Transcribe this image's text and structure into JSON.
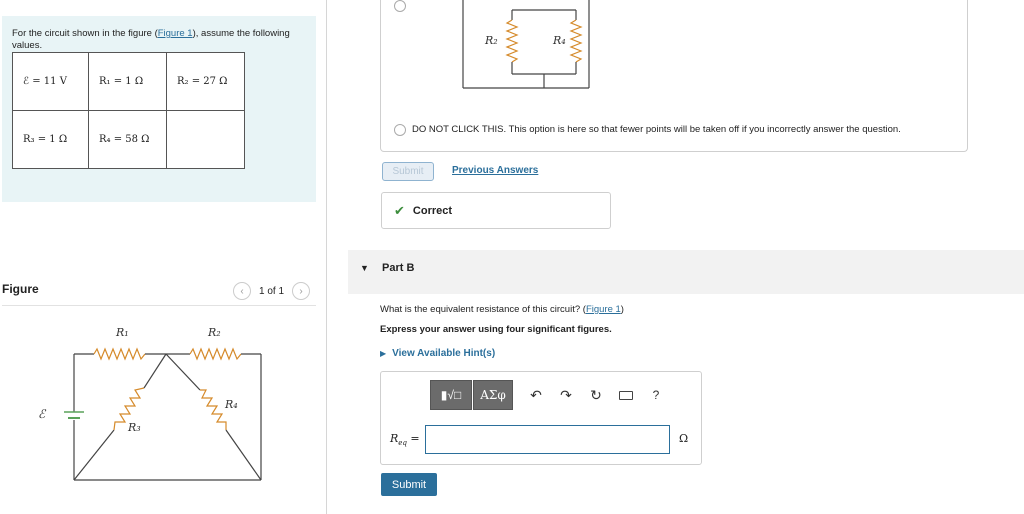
{
  "problem": {
    "intro": "For the circuit shown in the figure (",
    "figure_link": "Figure 1",
    "intro_end": "), assume the following values."
  },
  "values": {
    "row1": [
      "ℰ = 11 V",
      "R₁ = 1 Ω",
      "R₂ = 27 Ω"
    ],
    "row2": [
      "R₃ = 1 Ω",
      "R₄ = 58 Ω",
      ""
    ]
  },
  "figure": {
    "label": "Figure",
    "pager_text": "1 of 1",
    "labels": {
      "r1": "R₁",
      "r2": "R₂",
      "r3": "R₃",
      "r4": "R₄",
      "emf": "ℰ"
    }
  },
  "options": {
    "top_labels": {
      "r2": "R₂",
      "r4": "R₄"
    },
    "dont_click": "DO NOT CLICK THIS. This option is here so that fewer points will be taken off if you incorrectly answer the question."
  },
  "submission": {
    "submit_label": "Submit",
    "previous_answers": "Previous Answers",
    "correct_label": "Correct"
  },
  "part_b": {
    "title": "Part B",
    "question": "What is the equivalent resistance of this circuit? (",
    "figure_link": "Figure 1",
    "question_end": ")",
    "instruction": "Express your answer using four significant figures.",
    "hints": "View Available Hint(s)",
    "toolbar": {
      "template": "▮√□",
      "greek": "ΑΣφ",
      "help": "?"
    },
    "answer_label": "R",
    "answer_label_sub": "eq",
    "answer_label_eq": " =",
    "answer_value": "",
    "unit": "Ω",
    "submit_label": "Submit"
  },
  "colors": {
    "accent": "#2b6f9b",
    "correct": "#3c8d3c",
    "panel_bg": "#e8f4f6"
  }
}
